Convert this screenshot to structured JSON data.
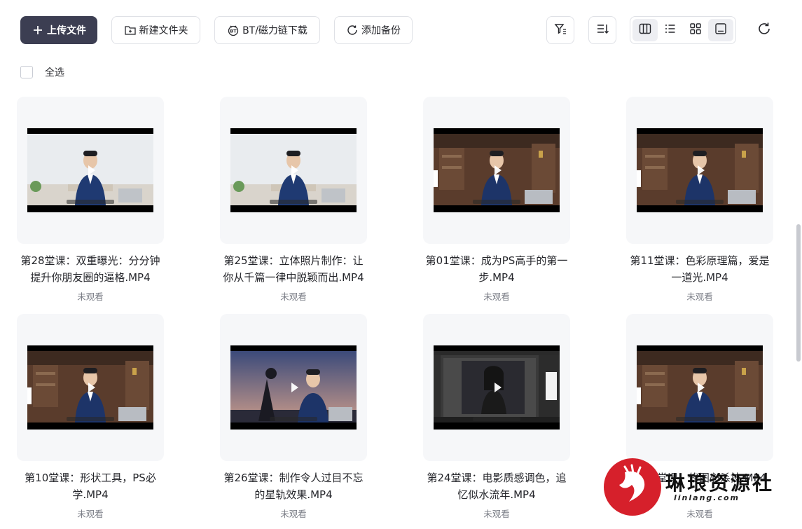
{
  "toolbar": {
    "upload_label": "上传文件",
    "new_folder_label": "新建文件夹",
    "bt_label": "BT/磁力链下载",
    "backup_label": "添加备份"
  },
  "select_all": {
    "label": "全选"
  },
  "files": [
    {
      "title": "第28堂课：双重曝光：分分钟提升你朋友圈的逼格.MP4",
      "status": "未观看",
      "scene": "bright"
    },
    {
      "title": "第25堂课：立体照片制作：让你从千篇一律中脱颖而出.MP4",
      "status": "未观看",
      "scene": "bright"
    },
    {
      "title": "第01堂课：成为PS高手的第一步.MP4",
      "status": "未观看",
      "scene": "studio"
    },
    {
      "title": "第11堂课：色彩原理篇，爱是一道光.MP4",
      "status": "未观看",
      "scene": "studio"
    },
    {
      "title": "第10堂课：形状工具，PS必学.MP4",
      "status": "未观看",
      "scene": "studio"
    },
    {
      "title": "第26堂课：制作令人过目不忘的星轨效果.MP4",
      "status": "未观看",
      "scene": "outdoor"
    },
    {
      "title": "第24堂课：电影质感调色，追忆似水流年.MP4",
      "status": "未观看",
      "scene": "screen"
    },
    {
      "title": "第27堂课：修图必杀技.MP4",
      "status": "未观看",
      "scene": "studio"
    }
  ],
  "watermark": {
    "text": "琳琅资源社",
    "sub": "linlang.com"
  },
  "colors": {
    "primary": "#3c3e52",
    "card_bg": "#f6f7f9",
    "status_text": "#7a7d86",
    "watermark_red": "#d6202b"
  }
}
